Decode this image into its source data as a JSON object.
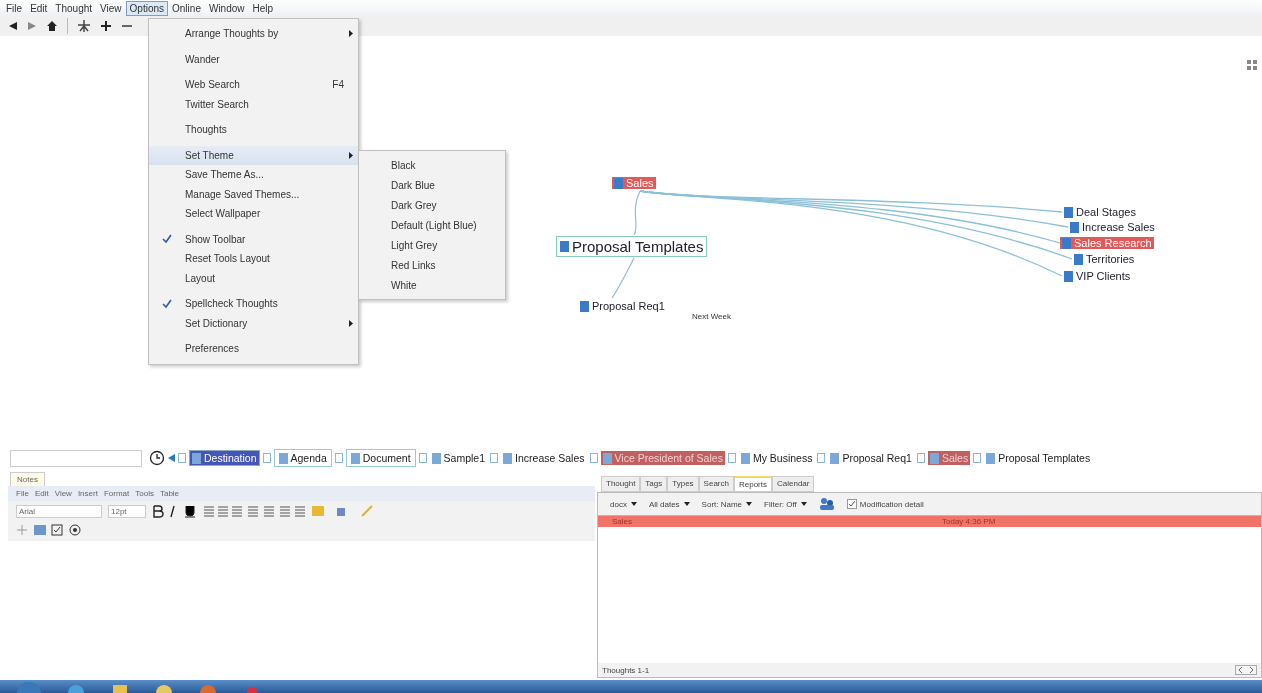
{
  "menu_bar": [
    {
      "label": "File",
      "selected": false
    },
    {
      "label": "Edit",
      "selected": false
    },
    {
      "label": "Thought",
      "selected": false
    },
    {
      "label": "View",
      "selected": false
    },
    {
      "label": "Options",
      "selected": true
    },
    {
      "label": "Online",
      "selected": false
    },
    {
      "label": "Window",
      "selected": false
    },
    {
      "label": "Help",
      "selected": false
    }
  ],
  "options_menu": [
    [
      {
        "label": "Arrange Thoughts by",
        "submenu": true,
        "checked": false,
        "selected": false
      }
    ],
    [
      {
        "label": "Wander",
        "submenu": false,
        "checked": false,
        "selected": false
      }
    ],
    [
      {
        "label": "Web Search",
        "shortcut": "F4",
        "submenu": false,
        "checked": false,
        "selected": false
      },
      {
        "label": "Twitter Search",
        "submenu": false,
        "checked": false,
        "selected": false
      }
    ],
    [
      {
        "label": "Thoughts",
        "submenu": false,
        "checked": false,
        "selected": false
      }
    ],
    [
      {
        "label": "Set Theme",
        "submenu": true,
        "checked": false,
        "selected": true
      },
      {
        "label": "Save Theme As...",
        "submenu": false,
        "checked": false,
        "selected": false
      },
      {
        "label": "Manage Saved Themes...",
        "submenu": false,
        "checked": false,
        "selected": false
      },
      {
        "label": "Select Wallpaper",
        "submenu": false,
        "checked": false,
        "selected": false
      }
    ],
    [
      {
        "label": "Show Toolbar",
        "submenu": false,
        "checked": true,
        "selected": false
      },
      {
        "label": "Reset Tools Layout",
        "submenu": false,
        "checked": false,
        "selected": false
      },
      {
        "label": "Layout",
        "submenu": false,
        "checked": false,
        "selected": false
      }
    ],
    [
      {
        "label": "Spellcheck Thoughts",
        "submenu": false,
        "checked": true,
        "selected": false
      },
      {
        "label": "Set Dictionary",
        "submenu": true,
        "checked": false,
        "selected": false
      }
    ],
    [
      {
        "label": "Preferences",
        "submenu": false,
        "checked": false,
        "selected": false
      }
    ]
  ],
  "theme_submenu": [
    "Black",
    "Dark Blue",
    "Dark Grey",
    "Default (Light Blue)",
    "Light Grey",
    "Red Links",
    "White"
  ],
  "plex": {
    "nodes": [
      {
        "label": "Sales",
        "highlighted": true,
        "kind": "normal"
      },
      {
        "label": "Proposal Templates",
        "highlighted": false,
        "kind": "active"
      },
      {
        "label": "Proposal Req1",
        "highlighted": false,
        "kind": "normal"
      },
      {
        "label": "Deal Stages",
        "highlighted": false,
        "kind": "normal"
      },
      {
        "label": "Increase Sales",
        "highlighted": false,
        "kind": "normal"
      },
      {
        "label": "Sales Research",
        "highlighted": true,
        "kind": "normal"
      },
      {
        "label": "Territories",
        "highlighted": false,
        "kind": "normal"
      },
      {
        "label": "VIP Clients",
        "highlighted": false,
        "kind": "normal"
      }
    ],
    "note": "Next Week"
  },
  "path_bar": [
    {
      "label": "Destination",
      "kind": "selected"
    },
    {
      "label": "Agenda",
      "kind": "boxed"
    },
    {
      "label": "Document",
      "kind": "boxed"
    },
    {
      "label": "Sample1",
      "kind": "plain"
    },
    {
      "label": "Increase Sales",
      "kind": "plain"
    },
    {
      "label": "Vice President of Sales",
      "kind": "highlighted"
    },
    {
      "label": "My Business",
      "kind": "plain"
    },
    {
      "label": "Proposal Req1",
      "kind": "plain"
    },
    {
      "label": "Sales",
      "kind": "highlighted"
    },
    {
      "label": "Proposal Templates",
      "kind": "plain"
    }
  ],
  "notes": {
    "tab": "Notes",
    "menu": [
      "File",
      "Edit",
      "View",
      "Insert",
      "Format",
      "Tools",
      "Table"
    ],
    "font": "Arial",
    "font_size": "12pt"
  },
  "reports": {
    "tabs": [
      {
        "label": "Thought",
        "selected": false
      },
      {
        "label": "Tags",
        "selected": false
      },
      {
        "label": "Types",
        "selected": false
      },
      {
        "label": "Search",
        "selected": false
      },
      {
        "label": "Reports",
        "selected": true
      },
      {
        "label": "Calendar",
        "selected": false
      }
    ],
    "filters": [
      "docx",
      "All dates",
      "Sort: Name",
      "Filter: Off"
    ],
    "detail": {
      "label": "Modification detail",
      "checked": true
    },
    "rows": [
      {
        "name": "Sales",
        "date": "Today 4:36 PM"
      }
    ],
    "status": "Thoughts 1-1"
  }
}
